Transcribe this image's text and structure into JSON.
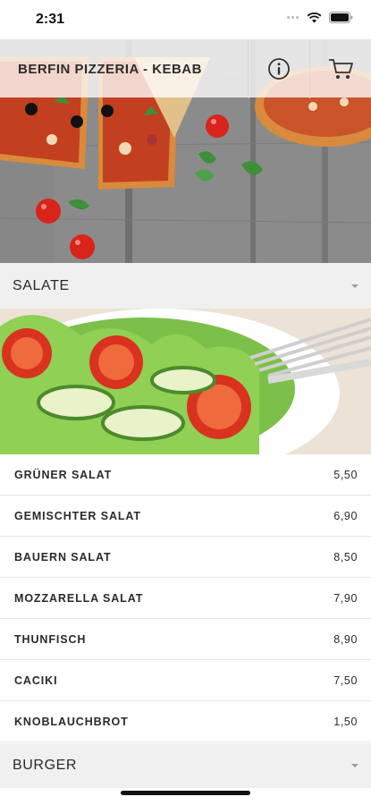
{
  "status_bar": {
    "time": "2:31"
  },
  "header": {
    "title": "BERFIN PIZZERIA - KEBAB",
    "info_icon": "info-icon",
    "cart_icon": "cart-icon"
  },
  "sections": [
    {
      "title": "SALATE",
      "items": [
        {
          "name": "GRÜNER SALAT",
          "price": "5,50"
        },
        {
          "name": "GEMISCHTER SALAT",
          "price": "6,90"
        },
        {
          "name": "BAUERN SALAT",
          "price": "8,50"
        },
        {
          "name": "MOZZARELLA SALAT",
          "price": "7,90"
        },
        {
          "name": "THUNFISCH",
          "price": "8,90"
        },
        {
          "name": "CACIKI",
          "price": "7,50"
        },
        {
          "name": "KNOBLAUCHBROT",
          "price": "1,50"
        }
      ]
    },
    {
      "title": "BURGER"
    }
  ],
  "colors": {
    "section_bg": "#f0f0f0",
    "tomato": "#d9241c",
    "basil": "#3f8f3a",
    "wood": "#8a8a8a"
  }
}
